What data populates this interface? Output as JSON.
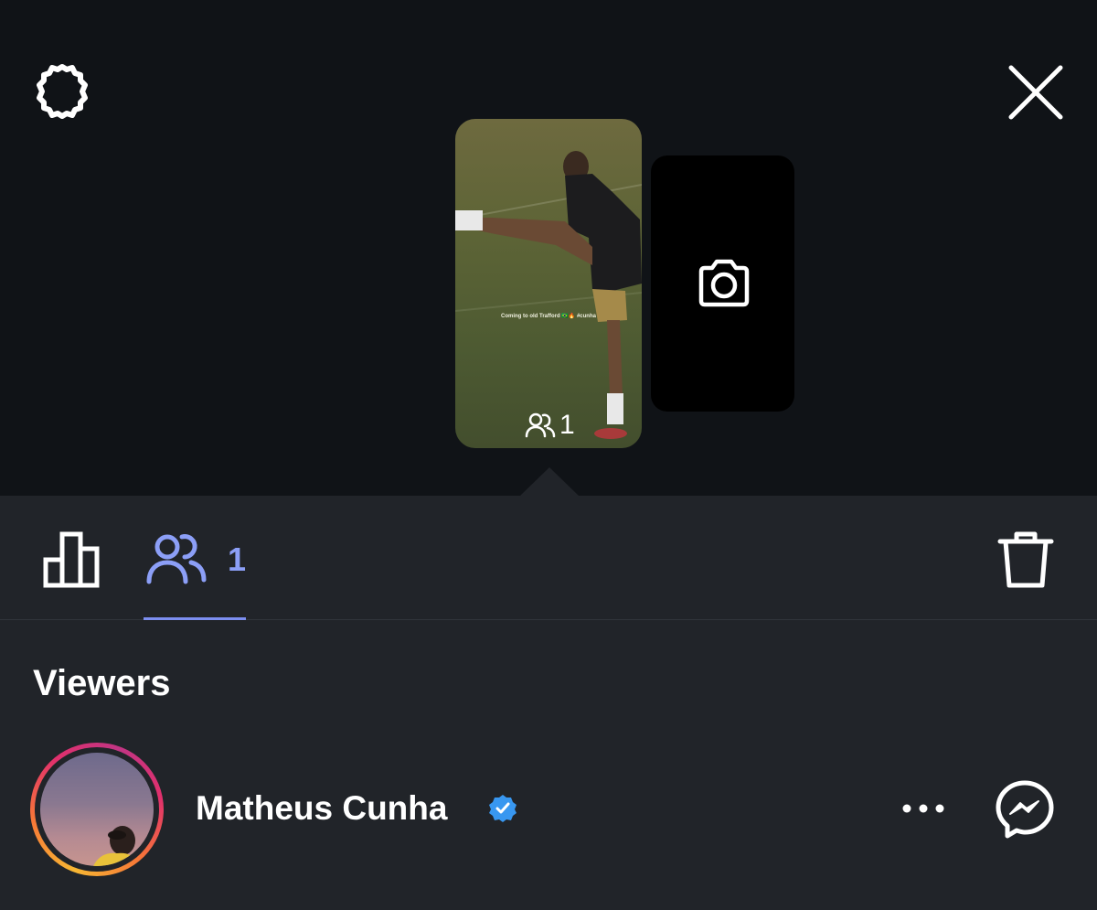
{
  "story": {
    "caption": "Coming to old Trafford 🇧🇷🔥 #cunha",
    "viewer_count": "1"
  },
  "tabs": {
    "viewers_count": "1"
  },
  "viewers": {
    "heading": "Viewers",
    "list": [
      {
        "name": "Matheus Cunha",
        "verified": true
      }
    ]
  },
  "colors": {
    "accent": "#8c9ff7",
    "panel": "#212429",
    "background": "#101317",
    "verified": "#3897f0"
  },
  "icons": {
    "settings": "gear-icon",
    "close": "close-icon",
    "camera": "camera-icon",
    "insights": "bar-chart-icon",
    "viewers": "people-icon",
    "delete": "trash-icon",
    "more": "more-dots-icon",
    "messenger": "messenger-icon"
  }
}
